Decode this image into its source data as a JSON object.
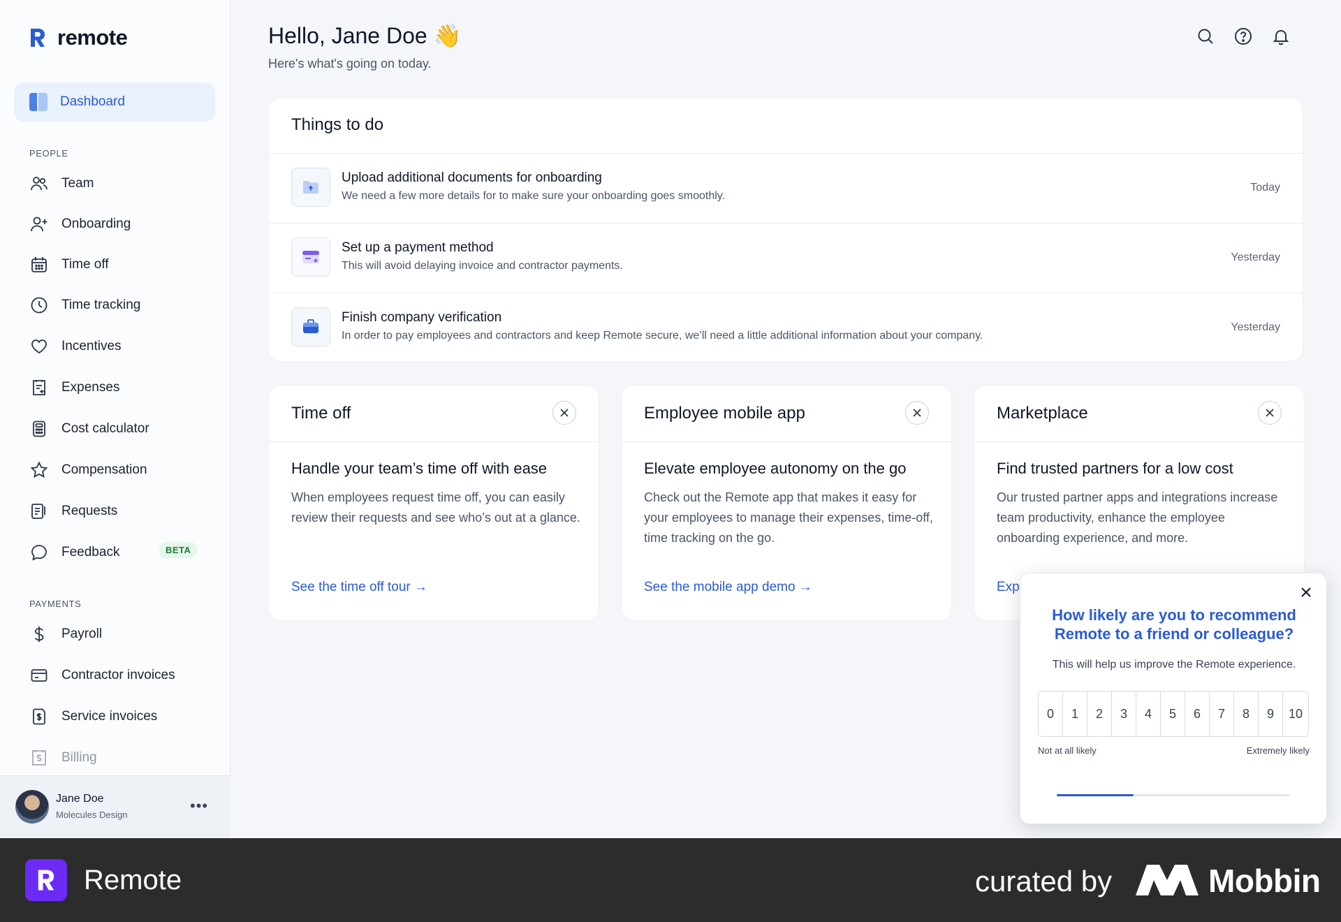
{
  "app": {
    "name": "remote"
  },
  "sidebar": {
    "active": {
      "label": "Dashboard"
    },
    "section_people": "PEOPLE",
    "people_items": [
      {
        "label": "Team",
        "icon": "team-icon"
      },
      {
        "label": "Onboarding",
        "icon": "user-plus-icon"
      },
      {
        "label": "Time off",
        "icon": "calendar-icon"
      },
      {
        "label": "Time tracking",
        "icon": "clock-icon"
      },
      {
        "label": "Incentives",
        "icon": "heart-icon"
      },
      {
        "label": "Expenses",
        "icon": "receipt-icon"
      },
      {
        "label": "Cost calculator",
        "icon": "calculator-icon"
      },
      {
        "label": "Compensation",
        "icon": "star-icon"
      },
      {
        "label": "Requests",
        "icon": "requests-icon"
      },
      {
        "label": "Feedback",
        "icon": "chat-bubble-icon",
        "badge": "BETA"
      }
    ],
    "section_payments": "PAYMENTS",
    "payment_items": [
      {
        "label": "Payroll",
        "icon": "dollar-icon"
      },
      {
        "label": "Contractor invoices",
        "icon": "card-icon"
      },
      {
        "label": "Service invoices",
        "icon": "invoice-icon"
      },
      {
        "label": "Billing",
        "icon": "billing-icon"
      }
    ],
    "user": {
      "name": "Jane Doe",
      "org": "Molecules Design",
      "more": "•••"
    }
  },
  "header": {
    "greeting": "Hello, Jane Doe 👋",
    "subtitle": "Here's what's going on today."
  },
  "todo": {
    "title": "Things to do",
    "items": [
      {
        "title": "Upload additional documents for onboarding",
        "desc": "We need a few more details for to make sure your onboarding goes smoothly.",
        "when": "Today"
      },
      {
        "title": "Set up a payment method",
        "desc": "This will avoid delaying invoice and contractor payments.",
        "when": "Yesterday"
      },
      {
        "title": "Finish company verification",
        "desc": "In order to pay employees and contractors and keep Remote secure, we’ll need a little additional information about your company.",
        "when": "Yesterday"
      }
    ]
  },
  "cards": [
    {
      "title": "Time off",
      "heading": "Handle your team’s time off with ease",
      "body": "When employees request time off, you can easily review their requests and see who’s out at a glance.",
      "link": "See the time off tour →"
    },
    {
      "title": "Employee mobile app",
      "heading": "Elevate employee autonomy on the go",
      "body": "Check out the Remote app that makes it easy for your employees to manage their expenses, time-off, time tracking on the go.",
      "link": "See the mobile app demo →"
    },
    {
      "title": "Marketplace",
      "heading": "Find trusted partners for a low cost",
      "body": "Our trusted partner apps and integrations increase team productivity, enhance the employee onboarding experience, and more.",
      "link": "Exp"
    }
  ],
  "survey": {
    "question": "How likely are you to recommend Remote to a friend or colleague?",
    "help": "This will help us improve the Remote experience.",
    "scale": [
      "0",
      "1",
      "2",
      "3",
      "4",
      "5",
      "6",
      "7",
      "8",
      "9",
      "10"
    ],
    "low_label": "Not at all likely",
    "high_label": "Extremely likely",
    "progress": 0.33
  },
  "footer": {
    "brand": "Remote",
    "curated": "curated by",
    "mobbin": "Mobbin"
  },
  "colors": {
    "accent": "#2a5bd7",
    "footer_bg": "#2c2c2c",
    "footer_logo": "#6c2bf5"
  }
}
